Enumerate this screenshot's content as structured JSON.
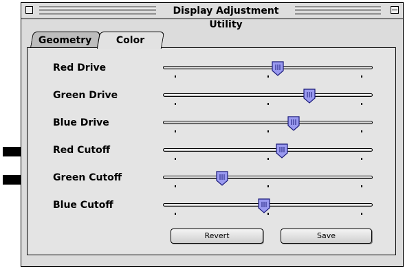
{
  "window": {
    "title": "Display Adjustment Utility"
  },
  "tabs": [
    {
      "label": "Geometry",
      "selected": false
    },
    {
      "label": "Color",
      "selected": true
    }
  ],
  "sliders": [
    {
      "label": "Red Drive",
      "value": 0.55
    },
    {
      "label": "Green Drive",
      "value": 0.71
    },
    {
      "label": "Blue Drive",
      "value": 0.63
    },
    {
      "label": "Red Cutoff",
      "value": 0.57
    },
    {
      "label": "Green Cutoff",
      "value": 0.27
    },
    {
      "label": "Blue Cutoff",
      "value": 0.48
    }
  ],
  "buttons": {
    "revert": "Revert",
    "save": "Save"
  },
  "annotations": {
    "arrows_point_to": [
      "Red Cutoff",
      "Green Cutoff"
    ]
  },
  "colors": {
    "thumb_fill": "#9a9af0",
    "thumb_stroke": "#1a1a7a",
    "arrow": "#000000"
  }
}
